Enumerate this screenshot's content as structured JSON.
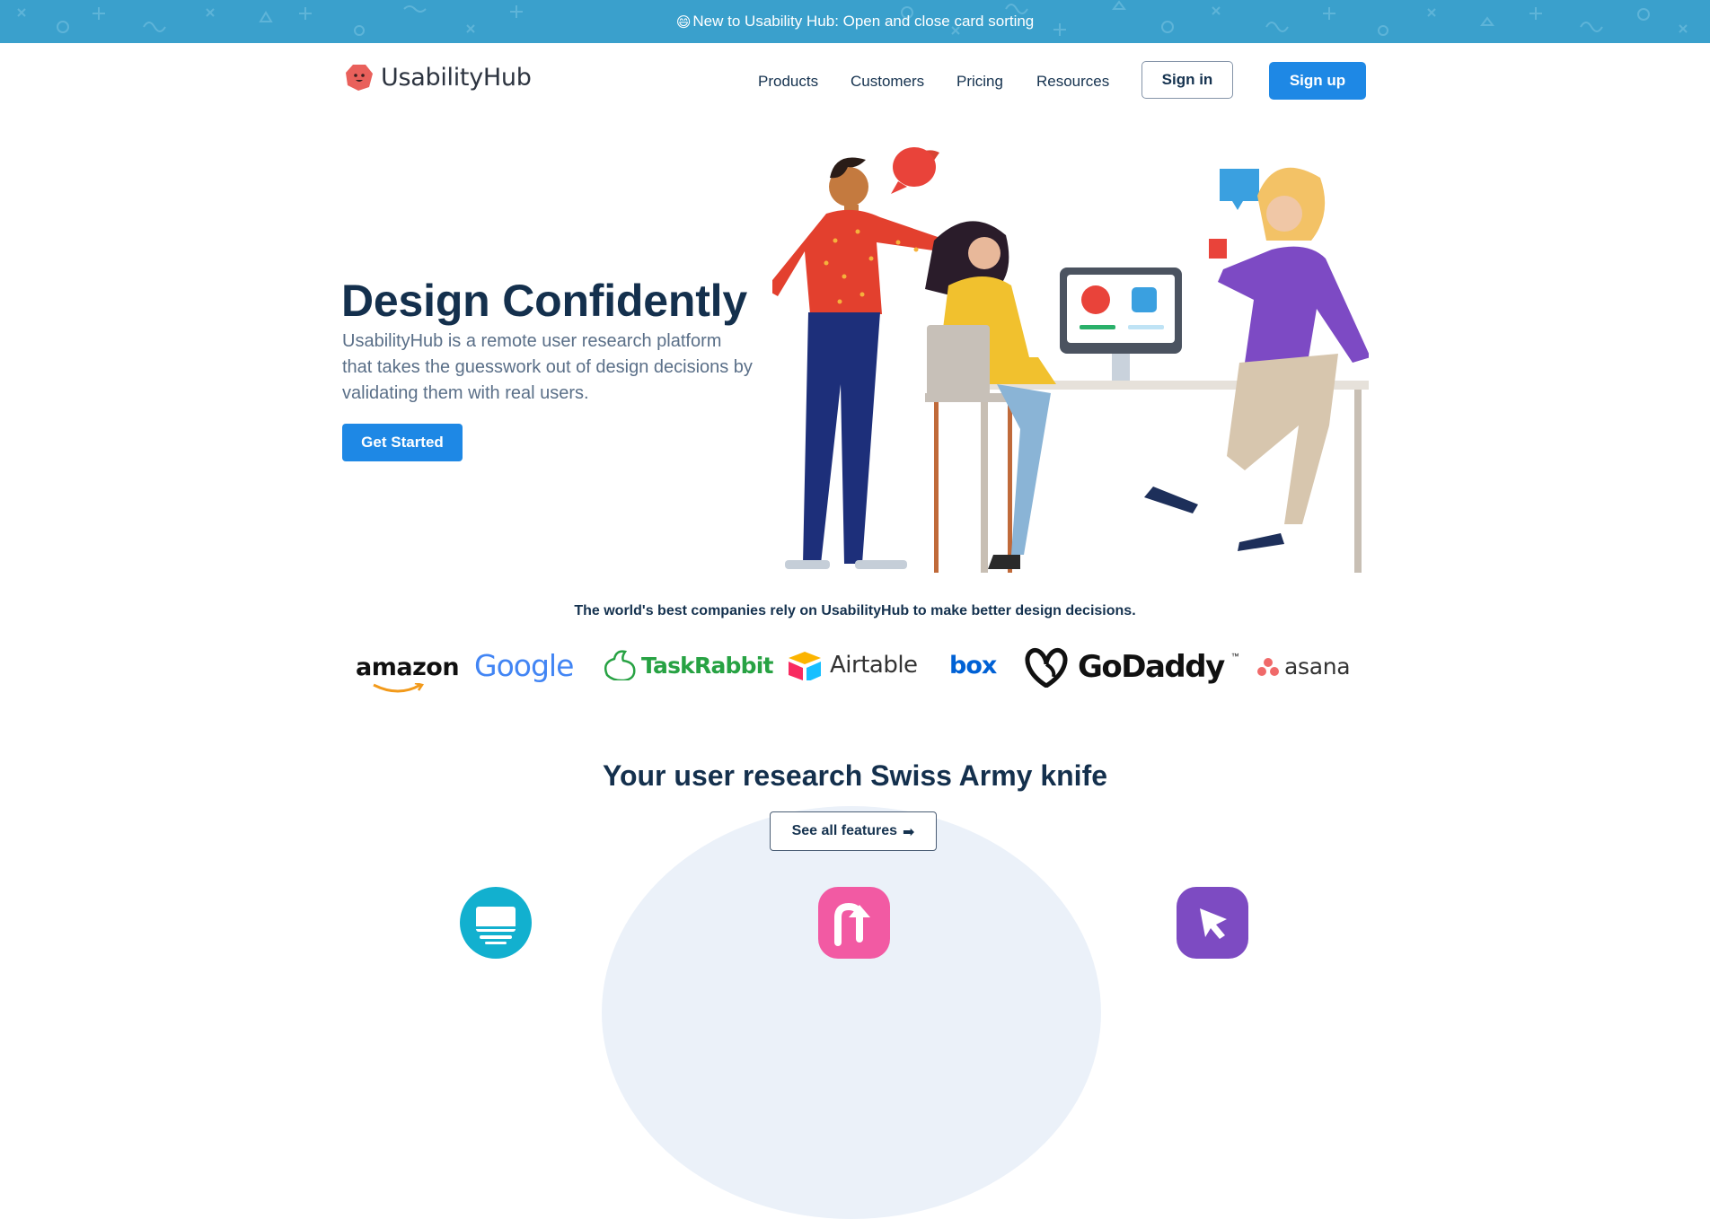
{
  "banner": {
    "emoji": "😄",
    "text": "New to Usability Hub: Open and close card sorting",
    "color": "#3aa0cc"
  },
  "header": {
    "logo_text": "UsabilityHub",
    "nav": [
      "Products",
      "Customers",
      "Pricing",
      "Resources"
    ],
    "signin_label": "Sign in",
    "signup_label": "Sign up"
  },
  "hero": {
    "title": "Design Confidently",
    "subtitle": "UsabilityHub is a remote user research platform that takes the guesswork out of design decisions by validating them with real users.",
    "cta": "Get Started"
  },
  "trust": {
    "text": "The world's best companies rely on UsabilityHub to make better design decisions.",
    "logos": [
      "amazon",
      "Google",
      "TaskRabbit",
      "Airtable",
      "box",
      "GoDaddy",
      "asana"
    ]
  },
  "features": {
    "title": "Your user research Swiss Army knife",
    "button": "See all features",
    "button_arrow": "➡",
    "icons": [
      "monitor-icon",
      "u-turn-arrow-icon",
      "cursor-icon"
    ]
  },
  "colors": {
    "primary": "#1e88e5",
    "heading": "#14304d",
    "banner": "#3aa0cc"
  }
}
